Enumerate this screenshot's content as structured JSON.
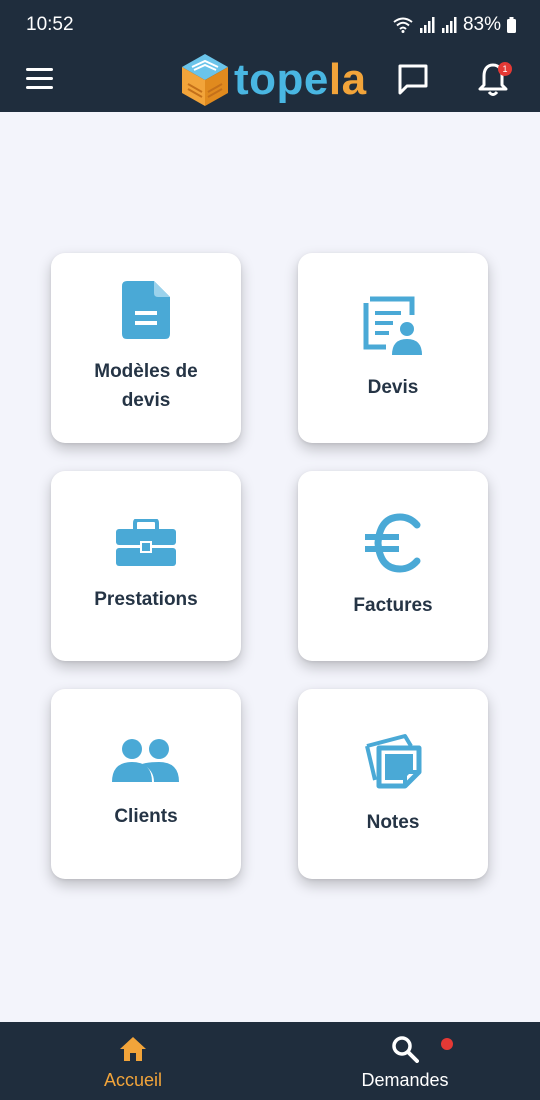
{
  "status_bar": {
    "time": "10:52",
    "battery": "83%"
  },
  "header": {
    "logo_part1": "tope",
    "logo_part2": "la",
    "notification_count": "1",
    "colors": {
      "background": "#1F2D3D",
      "logo_blue": "#49B6E2",
      "logo_orange": "#F2A43A"
    }
  },
  "cards": [
    {
      "label": "Modèles de devis",
      "icon": "document-icon"
    },
    {
      "label": "Devis",
      "icon": "quote-profile-icon"
    },
    {
      "label": "Prestations",
      "icon": "toolbox-icon"
    },
    {
      "label": "Factures",
      "icon": "euro-icon"
    },
    {
      "label": "Clients",
      "icon": "users-icon"
    },
    {
      "label": "Notes",
      "icon": "sticky-notes-icon"
    }
  ],
  "bottom_nav": {
    "items": [
      {
        "label": "Accueil",
        "icon": "home-icon",
        "active": true
      },
      {
        "label": "Demandes",
        "icon": "search-icon",
        "active": false
      }
    ],
    "colors": {
      "active": "#F2A43A",
      "inactive": "#FFFFFF",
      "dot": "#E53935"
    }
  },
  "colors": {
    "icon_blue": "#4AA9D6",
    "page_bg": "#F3F4FB",
    "card_text": "#253445"
  }
}
